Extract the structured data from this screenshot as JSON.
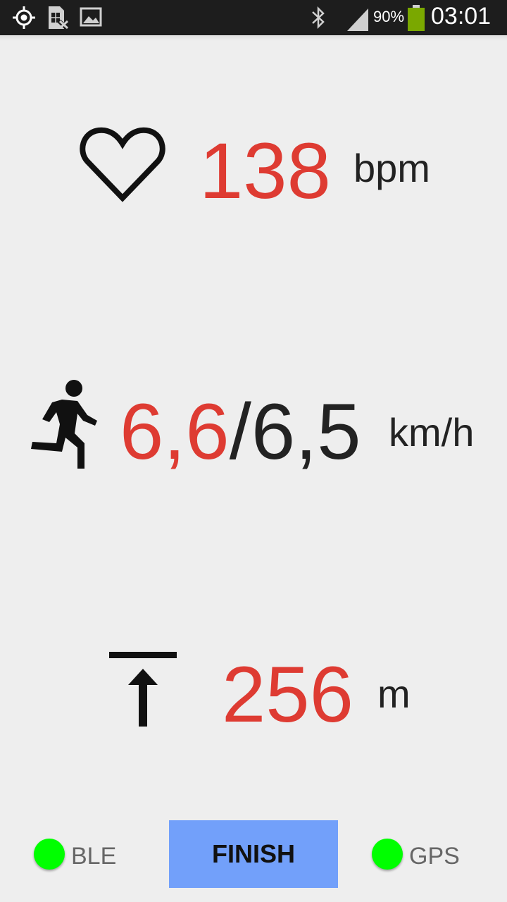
{
  "status_bar": {
    "battery_percent": "90%",
    "time": "03:01",
    "icons": [
      "location-icon",
      "sim-off-icon",
      "image-icon",
      "bluetooth-icon",
      "signal-icon",
      "battery-icon"
    ],
    "battery_color": "#7aa800"
  },
  "heart_rate": {
    "icon": "heart-icon",
    "value": "138",
    "unit": "bpm"
  },
  "speed": {
    "icon": "runner-icon",
    "current": "6,6",
    "separator": "/",
    "average": "6,5",
    "unit": "km/h"
  },
  "altitude": {
    "icon": "altitude-up-icon",
    "value": "256",
    "unit": "m"
  },
  "bottom_bar": {
    "ble_label": "BLE",
    "gps_label": "GPS",
    "finish_label": "FINISH",
    "indicator_color": "#00ff00",
    "finish_color": "#72a0fa"
  },
  "colors": {
    "value_red": "#de3b32",
    "text_dark": "#222222",
    "background": "#eeeeee"
  }
}
